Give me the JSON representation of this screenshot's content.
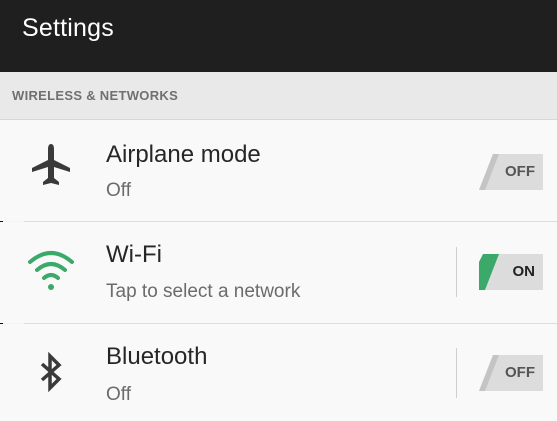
{
  "header": {
    "title": "Settings"
  },
  "section": {
    "label": "WIRELESS & NETWORKS"
  },
  "items": [
    {
      "title": "Airplane mode",
      "subtitle": "Off",
      "toggle": "OFF",
      "icon": "airplane-icon",
      "state": false
    },
    {
      "title": "Wi-Fi",
      "subtitle": "Tap to select a network",
      "toggle": "ON",
      "icon": "wifi-icon",
      "state": true
    },
    {
      "title": "Bluetooth",
      "subtitle": "Off",
      "toggle": "OFF",
      "icon": "bluetooth-icon",
      "state": false
    }
  ],
  "colors": {
    "header_bg": "#1f1f1f",
    "accent": "#3aa96a",
    "toggle_off": "#d9d9d9"
  }
}
